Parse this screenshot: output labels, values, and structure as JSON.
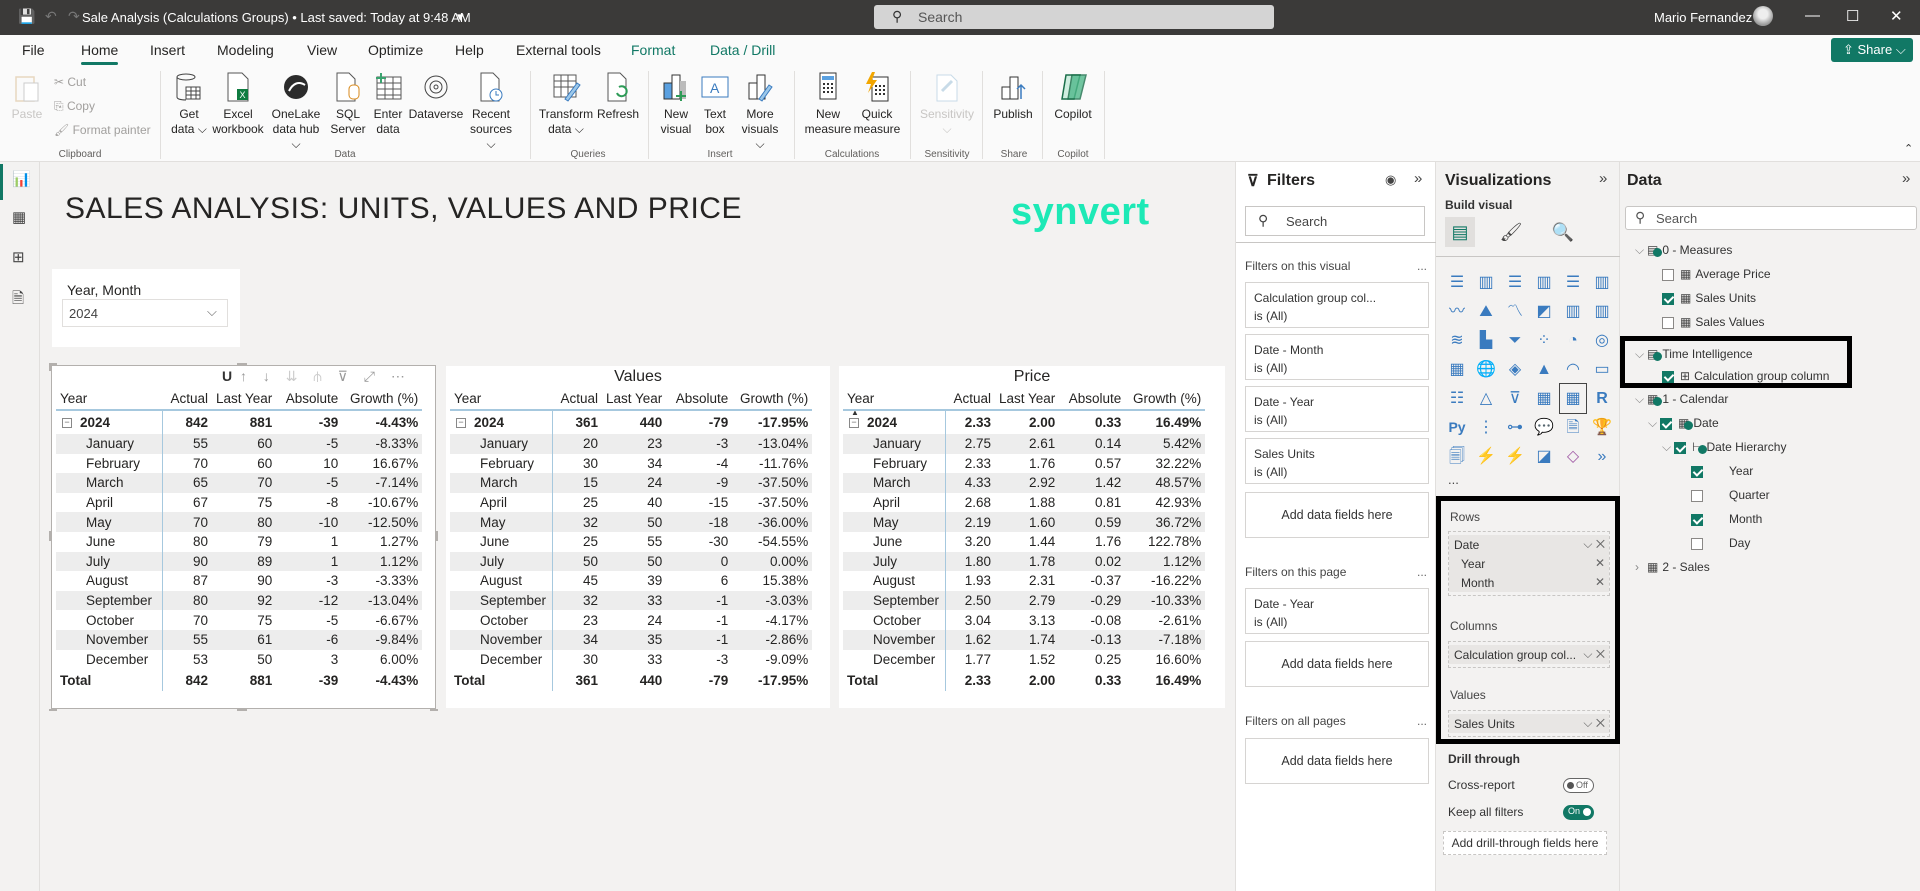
{
  "titlebar": {
    "title": "Sale Analysis (Calculations Groups) • Last saved: Today at 9:48 AM",
    "title_caret": "▾",
    "search_placeholder": "Search",
    "user_name": "Mario Fernandez",
    "icons": {
      "save": "💾",
      "undo": "↶",
      "redo": "↷",
      "search": "⚲",
      "minimize": "—",
      "maximize": "☐",
      "close": "✕"
    }
  },
  "menu": {
    "items": [
      "File",
      "Home",
      "Insert",
      "Modeling",
      "View",
      "Optimize",
      "Help",
      "External tools",
      "Format",
      "Data / Drill"
    ],
    "active": "Home",
    "share_label": "Share ⌵"
  },
  "ribbon": {
    "clipboard": {
      "paste": "Paste",
      "cut": "Cut",
      "copy": "Copy",
      "format_painter": "Format painter",
      "group": "Clipboard"
    },
    "data": {
      "buttons": [
        {
          "line1": "Get",
          "line2": "data ⌵"
        },
        {
          "line1": "Excel",
          "line2": "workbook"
        },
        {
          "line1": "OneLake",
          "line2": "data hub ⌵"
        },
        {
          "line1": "SQL",
          "line2": "Server"
        },
        {
          "line1": "Enter",
          "line2": "data"
        },
        {
          "line1": "Dataverse",
          "line2": ""
        },
        {
          "line1": "Recent",
          "line2": "sources ⌵"
        }
      ],
      "group": "Data"
    },
    "queries": {
      "buttons": [
        {
          "line1": "Transform",
          "line2": "data ⌵"
        },
        {
          "line1": "Refresh",
          "line2": ""
        }
      ],
      "group": "Queries"
    },
    "insert": {
      "buttons": [
        {
          "line1": "New",
          "line2": "visual"
        },
        {
          "line1": "Text",
          "line2": "box"
        },
        {
          "line1": "More",
          "line2": "visuals ⌵"
        }
      ],
      "group": "Insert"
    },
    "calculations": {
      "buttons": [
        {
          "line1": "New",
          "line2": "measure"
        },
        {
          "line1": "Quick",
          "line2": "measure"
        }
      ],
      "group": "Calculations"
    },
    "sensitivity": {
      "buttons": [
        {
          "line1": "Sensitivity",
          "line2": "⌵"
        }
      ],
      "group": "Sensitivity"
    },
    "share": {
      "buttons": [
        {
          "line1": "Publish",
          "line2": ""
        }
      ],
      "group": "Share"
    },
    "copilot": {
      "buttons": [
        {
          "line1": "Copilot",
          "line2": ""
        }
      ],
      "group": "Copilot"
    }
  },
  "report": {
    "title": "SALES ANALYSIS: UNITS, VALUES AND PRICE",
    "logo": "synvert",
    "logo_color": "#1de9b6",
    "slicer": {
      "label": "Year, Month",
      "value": "2024"
    }
  },
  "matrices": [
    {
      "title": "Units",
      "title_partial": "U",
      "headers": [
        "Year",
        "Actual",
        "Last Year",
        "Absolute",
        "Growth (%)"
      ],
      "year_row": {
        "label": "2024",
        "values": [
          "842",
          "881",
          "-39",
          "-4.43%"
        ]
      },
      "rows": [
        {
          "label": "January",
          "values": [
            "55",
            "60",
            "-5",
            "-8.33%"
          ]
        },
        {
          "label": "February",
          "values": [
            "70",
            "60",
            "10",
            "16.67%"
          ]
        },
        {
          "label": "March",
          "values": [
            "65",
            "70",
            "-5",
            "-7.14%"
          ]
        },
        {
          "label": "April",
          "values": [
            "67",
            "75",
            "-8",
            "-10.67%"
          ]
        },
        {
          "label": "May",
          "values": [
            "70",
            "80",
            "-10",
            "-12.50%"
          ]
        },
        {
          "label": "June",
          "values": [
            "80",
            "79",
            "1",
            "1.27%"
          ]
        },
        {
          "label": "July",
          "values": [
            "90",
            "89",
            "1",
            "1.12%"
          ]
        },
        {
          "label": "August",
          "values": [
            "87",
            "90",
            "-3",
            "-3.33%"
          ]
        },
        {
          "label": "September",
          "values": [
            "80",
            "92",
            "-12",
            "-13.04%"
          ]
        },
        {
          "label": "October",
          "values": [
            "70",
            "75",
            "-5",
            "-6.67%"
          ]
        },
        {
          "label": "November",
          "values": [
            "55",
            "61",
            "-6",
            "-9.84%"
          ]
        },
        {
          "label": "December",
          "values": [
            "53",
            "50",
            "3",
            "6.00%"
          ]
        }
      ],
      "total_row": {
        "label": "Total",
        "values": [
          "842",
          "881",
          "-39",
          "-4.43%"
        ]
      }
    },
    {
      "title": "Values",
      "headers": [
        "Year",
        "Actual",
        "Last Year",
        "Absolute",
        "Growth (%)"
      ],
      "year_row": {
        "label": "2024",
        "values": [
          "361",
          "440",
          "-79",
          "-17.95%"
        ]
      },
      "rows": [
        {
          "label": "January",
          "values": [
            "20",
            "23",
            "-3",
            "-13.04%"
          ]
        },
        {
          "label": "February",
          "values": [
            "30",
            "34",
            "-4",
            "-11.76%"
          ]
        },
        {
          "label": "March",
          "values": [
            "15",
            "24",
            "-9",
            "-37.50%"
          ]
        },
        {
          "label": "April",
          "values": [
            "25",
            "40",
            "-15",
            "-37.50%"
          ]
        },
        {
          "label": "May",
          "values": [
            "32",
            "50",
            "-18",
            "-36.00%"
          ]
        },
        {
          "label": "June",
          "values": [
            "25",
            "55",
            "-30",
            "-54.55%"
          ]
        },
        {
          "label": "July",
          "values": [
            "50",
            "50",
            "0",
            "0.00%"
          ]
        },
        {
          "label": "August",
          "values": [
            "45",
            "39",
            "6",
            "15.38%"
          ]
        },
        {
          "label": "September",
          "values": [
            "32",
            "33",
            "-1",
            "-3.03%"
          ]
        },
        {
          "label": "October",
          "values": [
            "23",
            "24",
            "-1",
            "-4.17%"
          ]
        },
        {
          "label": "November",
          "values": [
            "34",
            "35",
            "-1",
            "-2.86%"
          ]
        },
        {
          "label": "December",
          "values": [
            "30",
            "33",
            "-3",
            "-9.09%"
          ]
        }
      ],
      "total_row": {
        "label": "Total",
        "values": [
          "361",
          "440",
          "-79",
          "-17.95%"
        ]
      }
    },
    {
      "title": "Price",
      "headers": [
        "Year",
        "Actual",
        "Last Year",
        "Absolute",
        "Growth (%)"
      ],
      "year_row": {
        "label": "2024",
        "values": [
          "2.33",
          "2.00",
          "0.33",
          "16.49%"
        ]
      },
      "rows": [
        {
          "label": "January",
          "values": [
            "2.75",
            "2.61",
            "0.14",
            "5.42%"
          ]
        },
        {
          "label": "February",
          "values": [
            "2.33",
            "1.76",
            "0.57",
            "32.22%"
          ]
        },
        {
          "label": "March",
          "values": [
            "4.33",
            "2.92",
            "1.42",
            "48.57%"
          ]
        },
        {
          "label": "April",
          "values": [
            "2.68",
            "1.88",
            "0.81",
            "42.93%"
          ]
        },
        {
          "label": "May",
          "values": [
            "2.19",
            "1.60",
            "0.59",
            "36.72%"
          ]
        },
        {
          "label": "June",
          "values": [
            "3.20",
            "1.44",
            "1.76",
            "122.78%"
          ]
        },
        {
          "label": "July",
          "values": [
            "1.80",
            "1.78",
            "0.02",
            "1.12%"
          ]
        },
        {
          "label": "August",
          "values": [
            "1.93",
            "2.31",
            "-0.37",
            "-16.22%"
          ]
        },
        {
          "label": "September",
          "values": [
            "2.50",
            "2.79",
            "-0.29",
            "-10.33%"
          ]
        },
        {
          "label": "October",
          "values": [
            "3.04",
            "3.13",
            "-0.08",
            "-2.61%"
          ]
        },
        {
          "label": "November",
          "values": [
            "1.62",
            "1.74",
            "-0.13",
            "-7.18%"
          ]
        },
        {
          "label": "December",
          "values": [
            "1.77",
            "1.52",
            "0.25",
            "16.60%"
          ]
        }
      ],
      "total_row": {
        "label": "Total",
        "values": [
          "2.33",
          "2.00",
          "0.33",
          "16.49%"
        ]
      }
    }
  ],
  "filters": {
    "title": "Filters",
    "search_placeholder": "Search",
    "on_visual_label": "Filters on this visual",
    "on_visual": [
      {
        "name": "Calculation group col...",
        "state": "is (All)"
      },
      {
        "name": "Date - Month",
        "state": "is (All)"
      },
      {
        "name": "Date - Year",
        "state": "is (All)"
      },
      {
        "name": "Sales Units",
        "state": "is (All)"
      }
    ],
    "on_page_label": "Filters on this page",
    "on_page": [
      {
        "name": "Date - Year",
        "state": "is (All)"
      }
    ],
    "on_all_label": "Filters on all pages",
    "add_fields": "Add data fields here",
    "more": "..."
  },
  "visualizations": {
    "title": "Visualizations",
    "build_visual": "Build visual",
    "more_visuals": "...",
    "rows_label": "Rows",
    "rows_fields": [
      {
        "name": "Date",
        "sub": false
      },
      {
        "name": "Year",
        "sub": true
      },
      {
        "name": "Month",
        "sub": true
      }
    ],
    "columns_label": "Columns",
    "columns_fields": [
      "Calculation group col..."
    ],
    "values_label": "Values",
    "values_fields": [
      "Sales Units"
    ],
    "drill_through": "Drill through",
    "cross_report": "Cross-report",
    "cross_report_state": "Off",
    "keep_filters": "Keep all filters",
    "keep_filters_state": "On",
    "drill_add": "Add drill-through fields here"
  },
  "data_pane": {
    "title": "Data",
    "search_placeholder": "Search",
    "tree": [
      {
        "label": "0 - Measures",
        "level": 0,
        "expanded": true,
        "checkbox": null,
        "icon": "measure-table"
      },
      {
        "label": "Average Price",
        "level": 1,
        "checkbox": false,
        "icon": "calculator"
      },
      {
        "label": "Sales Units",
        "level": 1,
        "checkbox": true,
        "icon": "calculator"
      },
      {
        "label": "Sales Values",
        "level": 1,
        "checkbox": false,
        "icon": "calculator"
      },
      {
        "label": "Time Intelligence",
        "level": 0,
        "expanded": true,
        "checkbox": null,
        "icon": "calc-group"
      },
      {
        "label": "Calculation group column",
        "level": 1,
        "checkbox": true,
        "icon": "calc-column"
      },
      {
        "label": "1 - Calendar",
        "level": 0,
        "expanded": true,
        "checkbox": null,
        "icon": "table"
      },
      {
        "label": "Date",
        "level": 1,
        "expanded": true,
        "checkbox": true,
        "icon": "calendar"
      },
      {
        "label": "Date Hierarchy",
        "level": 2,
        "expanded": true,
        "checkbox": true,
        "icon": "hierarchy"
      },
      {
        "label": "Year",
        "level": 3,
        "checkbox": true
      },
      {
        "label": "Quarter",
        "level": 3,
        "checkbox": false
      },
      {
        "label": "Month",
        "level": 3,
        "checkbox": true
      },
      {
        "label": "Day",
        "level": 3,
        "checkbox": false
      },
      {
        "label": "2 - Sales",
        "level": 0,
        "expanded": false,
        "checkbox": null,
        "icon": "table"
      }
    ]
  },
  "colors": {
    "accent": "#117865",
    "titlebar": "#3b3a39",
    "highlight_border": "#000000"
  }
}
